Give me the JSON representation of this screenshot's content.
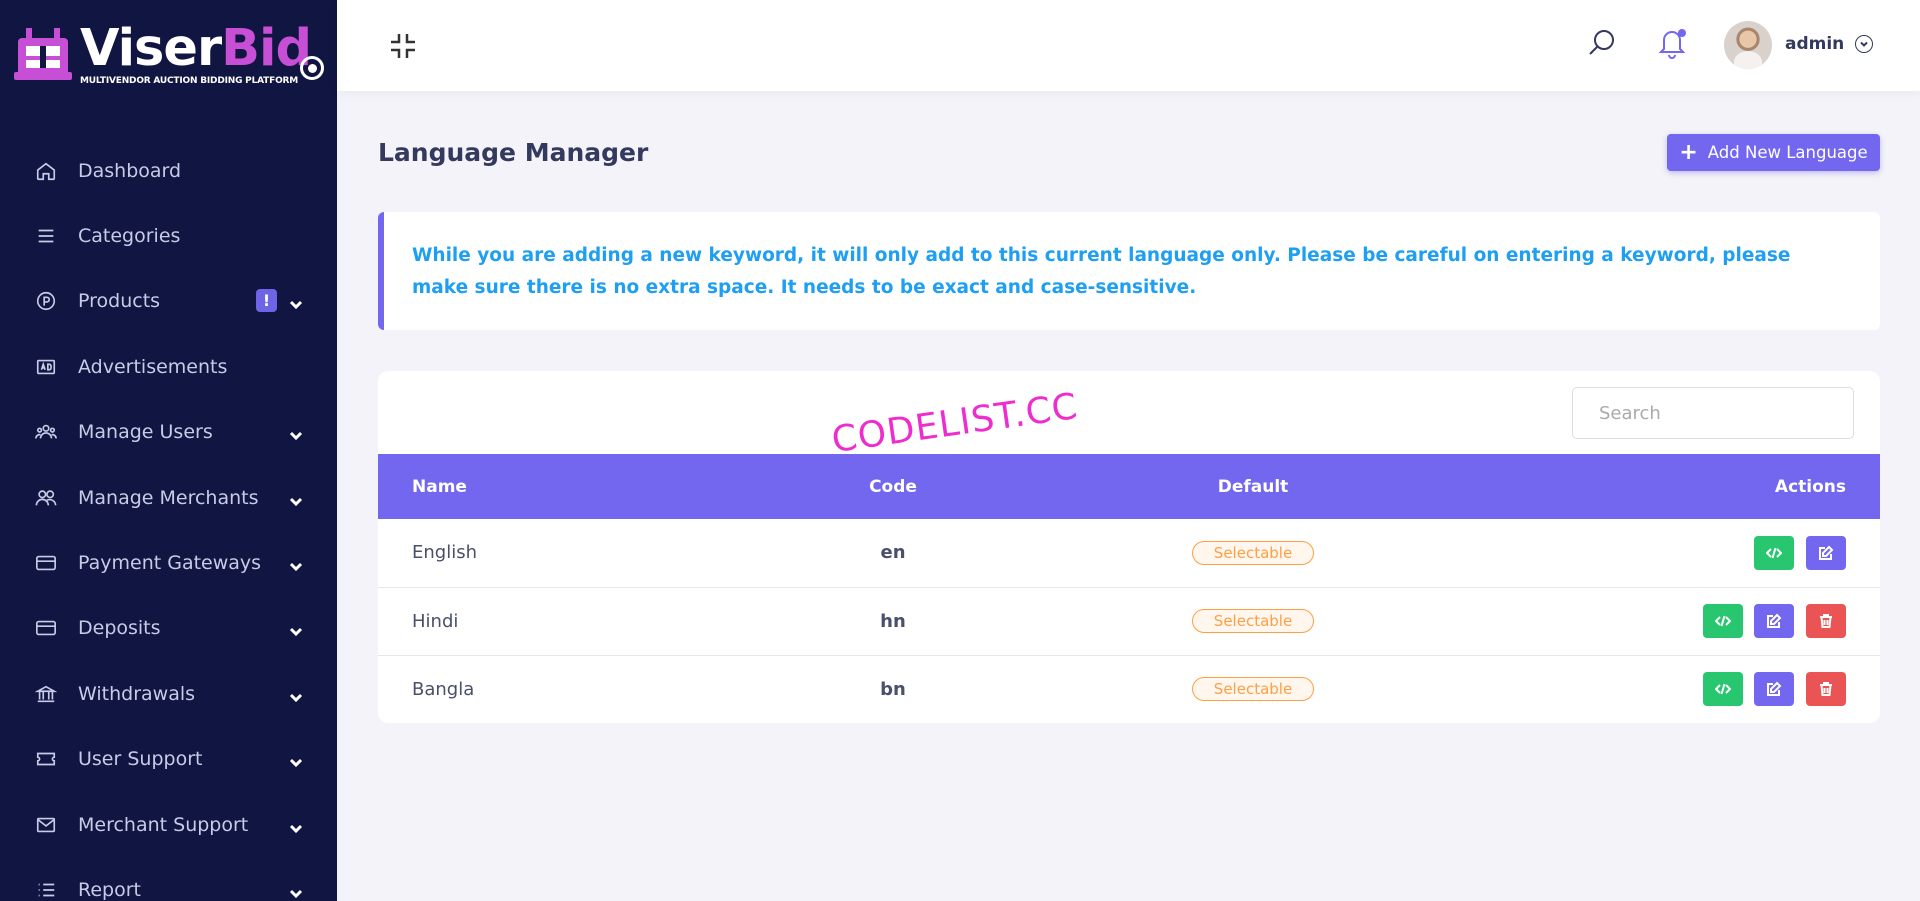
{
  "brand": {
    "name_main": "Viser",
    "name_accent": "Bid",
    "tagline": "MULTIVENDOR AUCTION BIDDING PLATFORM",
    "accent_color": "#c64fd6"
  },
  "sidebar": {
    "background": "#111542",
    "items": [
      {
        "label": "Dashboard",
        "icon": "home-icon",
        "has_submenu": false
      },
      {
        "label": "Categories",
        "icon": "menu-icon",
        "has_submenu": false
      },
      {
        "label": "Products",
        "icon": "product-icon",
        "has_submenu": true,
        "badge": "!"
      },
      {
        "label": "Advertisements",
        "icon": "ad-icon",
        "has_submenu": false
      },
      {
        "label": "Manage Users",
        "icon": "users-icon",
        "has_submenu": true
      },
      {
        "label": "Manage Merchants",
        "icon": "merchants-icon",
        "has_submenu": true
      },
      {
        "label": "Payment Gateways",
        "icon": "card-icon",
        "has_submenu": true
      },
      {
        "label": "Deposits",
        "icon": "card-icon",
        "has_submenu": true
      },
      {
        "label": "Withdrawals",
        "icon": "bank-icon",
        "has_submenu": true
      },
      {
        "label": "User Support",
        "icon": "ticket-icon",
        "has_submenu": true
      },
      {
        "label": "Merchant Support",
        "icon": "mail-icon",
        "has_submenu": true
      },
      {
        "label": "Report",
        "icon": "list-icon",
        "has_submenu": true
      }
    ]
  },
  "topbar": {
    "user_name": "admin"
  },
  "page": {
    "title": "Language Manager",
    "add_button_label": "Add New Language",
    "accent_color": "#7367f0"
  },
  "alert": {
    "text": "While you are adding a new keyword, it will only add to this current language only. Please be careful on entering a keyword, please make sure there is no extra space. It needs to be exact and case-sensitive."
  },
  "table": {
    "search_placeholder": "Search",
    "columns": [
      "Name",
      "Code",
      "Default",
      "Actions"
    ],
    "rows": [
      {
        "name": "English",
        "code": "en",
        "default": "Selectable",
        "deletable": false
      },
      {
        "name": "Hindi",
        "code": "hn",
        "default": "Selectable",
        "deletable": true
      },
      {
        "name": "Bangla",
        "code": "bn",
        "default": "Selectable",
        "deletable": true
      }
    ]
  },
  "watermark": "CODELIST.CC"
}
